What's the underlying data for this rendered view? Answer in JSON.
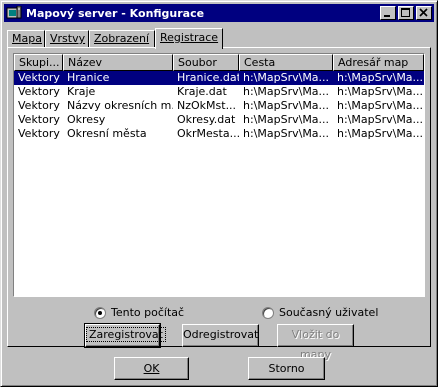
{
  "window": {
    "title": "Mapový server - Konfigurace",
    "app_icon": "map-server-icon"
  },
  "tabs": [
    {
      "label": "Mapa"
    },
    {
      "label": "Vrstvy"
    },
    {
      "label": "Zobrazení"
    },
    {
      "label": "Registrace"
    }
  ],
  "active_tab": "Registrace",
  "list": {
    "columns": [
      "Skupi...",
      "Název",
      "Soubor",
      "Cesta",
      "Adresář map"
    ],
    "rows": [
      [
        "Vektory",
        "Hranice",
        "Hranice.dat",
        "h:\\MapSrv\\Ma...",
        "h:\\MapSrv\\Ma..."
      ],
      [
        "Vektory",
        "Kraje",
        "Kraje.dat",
        "h:\\MapSrv\\Ma...",
        "h:\\MapSrv\\Ma..."
      ],
      [
        "Vektory",
        "Názvy okresních m...",
        "NzOkMst...",
        "h:\\MapSrv\\Ma...",
        "h:\\MapSrv\\Ma..."
      ],
      [
        "Vektory",
        "Okresy",
        "Okresy.dat",
        "h:\\MapSrv\\Ma...",
        "h:\\MapSrv\\Ma..."
      ],
      [
        "Vektory",
        "Okresní města",
        "OkrMesta...",
        "h:\\MapSrv\\Ma...",
        "h:\\MapSrv\\Ma..."
      ]
    ],
    "selected_row": 0
  },
  "radios": {
    "this_computer": {
      "label": "Tento počítač",
      "checked": true
    },
    "current_user": {
      "label": "Současný uživatel",
      "checked": false
    }
  },
  "buttons": {
    "register": "Zaregistrovat",
    "unregister": "Odregistrovat",
    "insert_to_map": "Vložit do mapy",
    "ok": "OK",
    "cancel": "Storno"
  },
  "colors": {
    "titlebar": "#000080",
    "face": "#c0c0c0",
    "selection": "#000080"
  }
}
